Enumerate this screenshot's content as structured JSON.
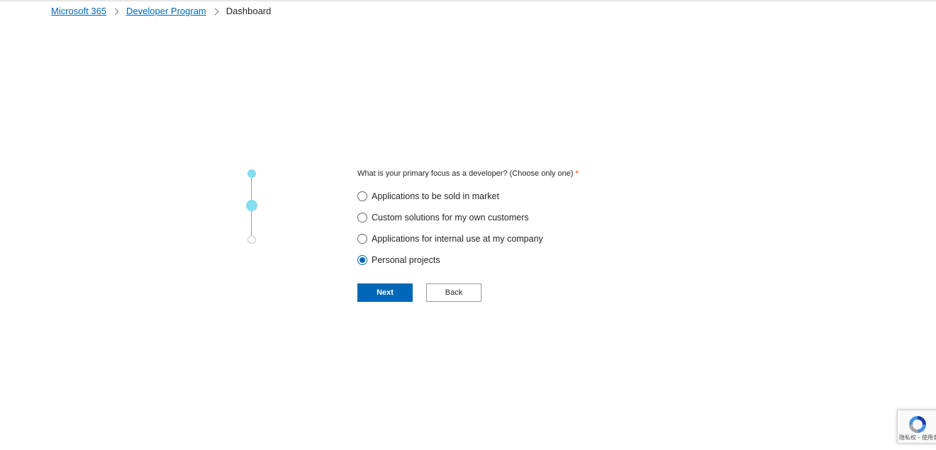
{
  "breadcrumb": {
    "items": [
      {
        "label": "Microsoft 365"
      },
      {
        "label": "Developer Program"
      }
    ],
    "current": "Dashboard"
  },
  "stepper": {
    "total_steps": 3,
    "current_step": 2
  },
  "form": {
    "question": "What is your primary focus as a developer? (Choose only one)",
    "required_marker": "*",
    "options": [
      {
        "label": "Applications to be sold in market",
        "selected": false
      },
      {
        "label": "Custom solutions for my own customers",
        "selected": false
      },
      {
        "label": "Applications for internal use at my company",
        "selected": false
      },
      {
        "label": "Personal projects",
        "selected": true
      }
    ],
    "next_label": "Next",
    "back_label": "Back"
  },
  "recaptcha": {
    "terms_text": "隐私权 - 使用条款"
  },
  "colors": {
    "accent": "#0067b8",
    "step_active": "#84dcf0",
    "required": "#d83b01"
  },
  "icons": {
    "breadcrumb_separator": "chevron-right-icon",
    "recaptcha_logo": "recaptcha-logo-icon"
  }
}
